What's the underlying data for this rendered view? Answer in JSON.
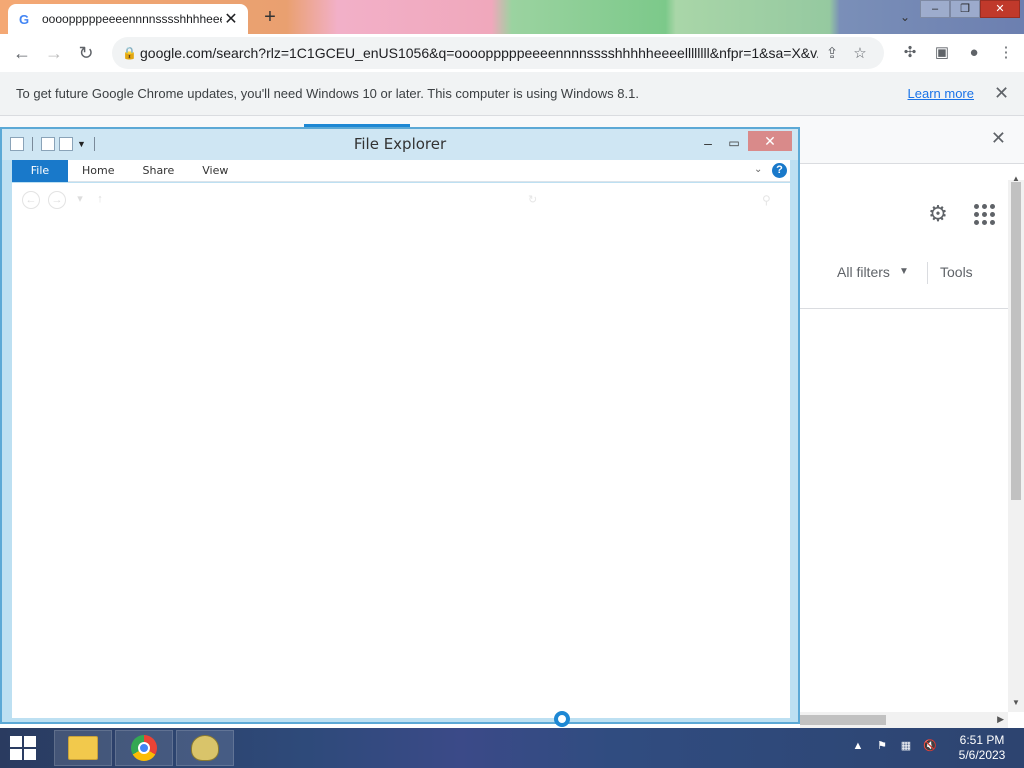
{
  "browser": {
    "tab": {
      "title": "oooopppppeeeennnnsssshhhheeeelllllll",
      "favicon": "G"
    },
    "new_tab": "+",
    "url": "google.com/search?rlz=1C1GCEU_enUS1056&q=oooopppppeeeennnnsssshhhhheeeellllllll&nfpr=1&sa=X&v...",
    "infobar": {
      "message": "To get future Google Chrome updates, you'll need Windows 10 or later. This computer is using Windows 8.1.",
      "link": "Learn more"
    },
    "search_page": {
      "all_filters": "All filters",
      "tools": "Tools"
    }
  },
  "file_explorer": {
    "title": "File Explorer",
    "ribbon_tabs": [
      "File",
      "Home",
      "Share",
      "View"
    ],
    "help": "?"
  },
  "taskbar": {
    "time": "6:51 PM",
    "date": "5/6/2023"
  }
}
